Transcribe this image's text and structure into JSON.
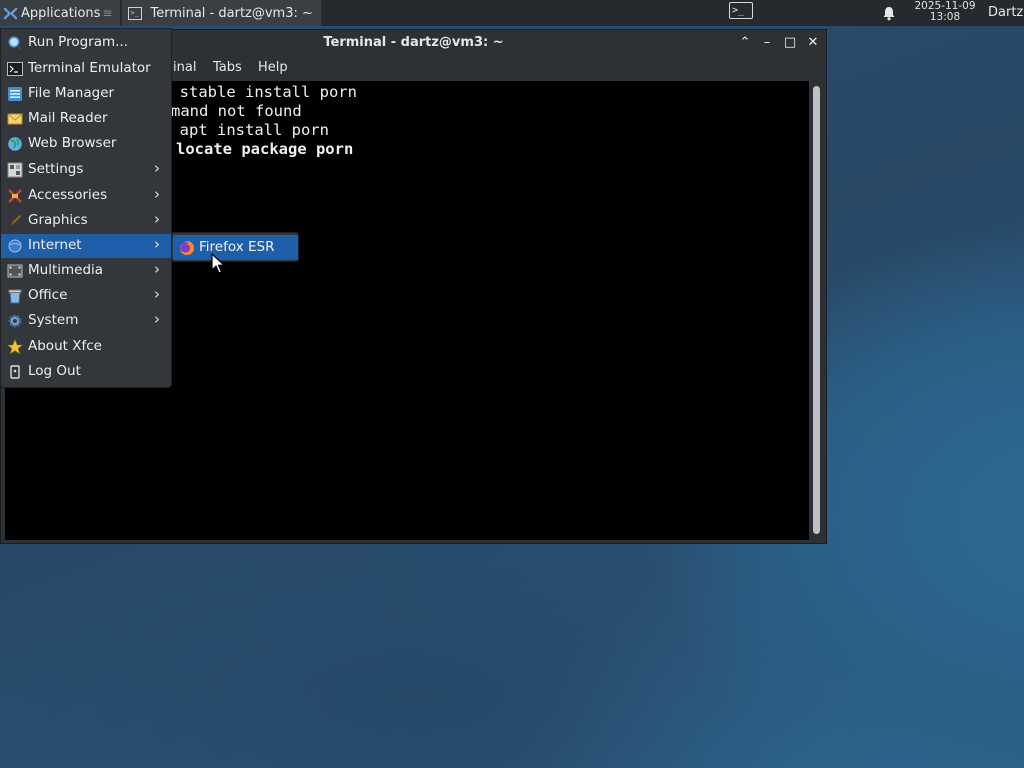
{
  "panel": {
    "applications_label": "Applications",
    "separator_glyph": "≡",
    "task_title": "Terminal - dartz@vm3: ~",
    "term_launcher_glyph": ">_",
    "clock_date": "2025-11-09",
    "clock_time": "13:08",
    "user": "Dartz"
  },
  "terminal": {
    "title": "Terminal - dartz@vm3: ~",
    "menu": [
      "inal",
      "Tabs",
      "Help"
    ],
    "lines": [
      "o stable install porn",
      "mand not found",
      "o apt install porn",
      "locate package porn"
    ],
    "controls": {
      "up": "⌃",
      "minimize": "–",
      "maximize": "□",
      "close": "✕"
    }
  },
  "apps_menu": {
    "items": [
      {
        "label": "Run Program...",
        "icon": "magnifier-icon"
      },
      {
        "label": "Terminal Emulator",
        "icon": "terminal-icon"
      },
      {
        "label": "File Manager",
        "icon": "file-manager-icon"
      },
      {
        "label": "Mail Reader",
        "icon": "mail-icon"
      },
      {
        "label": "Web Browser",
        "icon": "globe-icon"
      },
      {
        "label": "Settings",
        "icon": "settings-icon",
        "submenu": true
      },
      {
        "label": "Accessories",
        "icon": "accessories-icon",
        "submenu": true
      },
      {
        "label": "Graphics",
        "icon": "graphics-icon",
        "submenu": true
      },
      {
        "label": "Internet",
        "icon": "internet-icon",
        "submenu": true,
        "active": true
      },
      {
        "label": "Multimedia",
        "icon": "multimedia-icon",
        "submenu": true
      },
      {
        "label": "Office",
        "icon": "office-icon",
        "submenu": true
      },
      {
        "label": "System",
        "icon": "system-icon",
        "submenu": true
      },
      {
        "label": "About Xfce",
        "icon": "star-icon"
      },
      {
        "label": "Log Out",
        "icon": "logout-icon"
      }
    ],
    "arrow_glyph": "›",
    "submenu": {
      "label": "Firefox ESR",
      "icon": "firefox-icon"
    }
  },
  "colors": {
    "accent": "#1f5ea8",
    "panel": "#262a2e",
    "menu_bg": "#33373c",
    "terminal_bg": "#000000",
    "desktop": "#2b5278"
  }
}
